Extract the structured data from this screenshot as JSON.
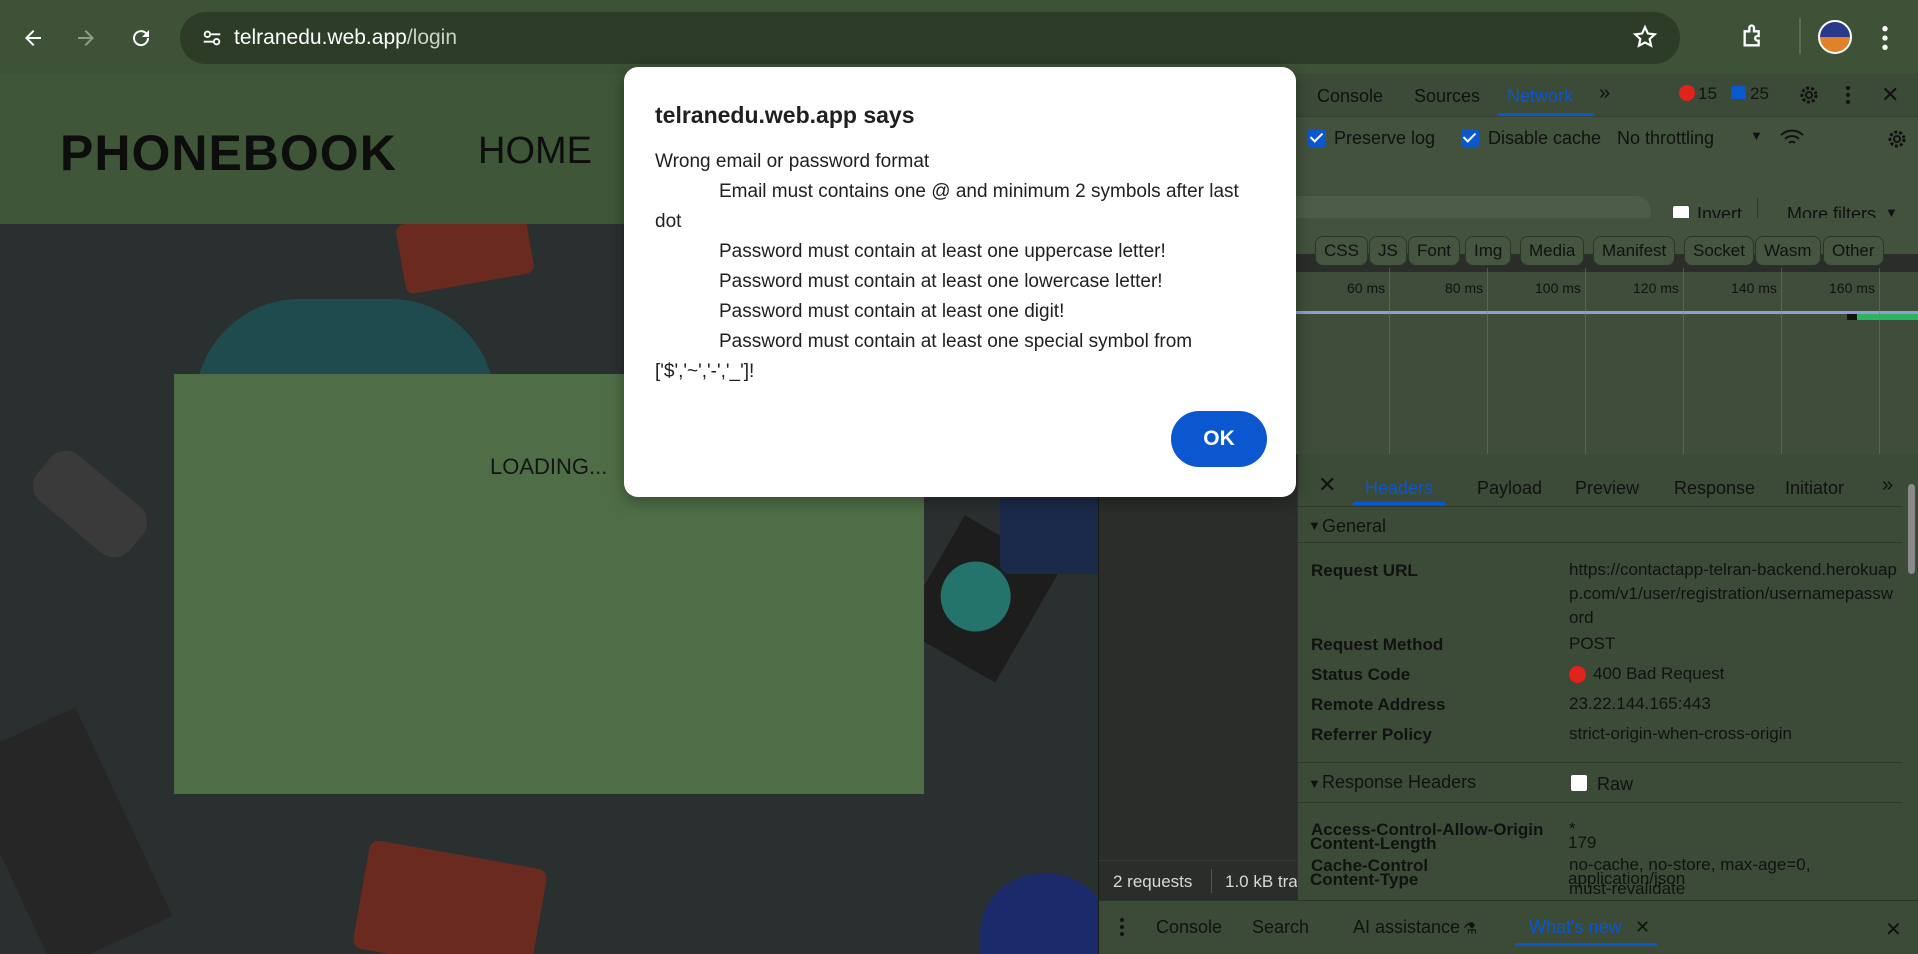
{
  "browser": {
    "url_host": "telranedu.web.app",
    "url_path": "/login"
  },
  "site": {
    "brand": "PHONEBOOK",
    "nav_home": "HOME",
    "loading": "LOADING..."
  },
  "alert": {
    "title": "telranedu.web.app says",
    "lines": [
      "Wrong email or password format",
      "Email must contains one @ and minimum 2 symbols after last dot",
      "Password must contain at least one uppercase letter!",
      "Password must contain at least one lowercase letter!",
      "Password must contain at least one digit!",
      "Password must contain at least one special symbol from ['$','~','-','_']!"
    ],
    "ok": "OK"
  },
  "devtools": {
    "tabs": {
      "console": "Console",
      "sources": "Sources",
      "network": "Network"
    },
    "errors": "15",
    "messages": "25",
    "preserve_log": "Preserve log",
    "disable_cache": "Disable cache",
    "throttling": "No throttling",
    "invert": "Invert",
    "more_filters": "More filters",
    "type_filters": [
      "CSS",
      "JS",
      "Font",
      "Img",
      "Media",
      "Manifest",
      "Socket",
      "Wasm",
      "Other"
    ],
    "ticks": [
      "60 ms",
      "80 ms",
      "100 ms",
      "120 ms",
      "140 ms",
      "160 ms"
    ],
    "footer": {
      "requests": "2 requests",
      "transferred": "1.0 kB tra"
    },
    "detail_tabs": {
      "headers": "Headers",
      "payload": "Payload",
      "preview": "Preview",
      "response": "Response",
      "initiator": "Initiator"
    },
    "general": {
      "title": "General",
      "request_url_key": "Request URL",
      "request_url": "https://contactapp-telran-backend.herokuapp.com/v1/user/registration/usernamepassword",
      "request_method_key": "Request Method",
      "request_method": "POST",
      "status_code_key": "Status Code",
      "status_code": "400 Bad Request",
      "remote_address_key": "Remote Address",
      "remote_address": "23.22.144.165:443",
      "referrer_policy_key": "Referrer Policy",
      "referrer_policy": "strict-origin-when-cross-origin"
    },
    "response_headers": {
      "title": "Response Headers",
      "raw": "Raw",
      "acao_key": "Access-Control-Allow-Origin",
      "acao": "*",
      "cache_control_key": "Cache-Control",
      "cache_control": "no-cache, no-store, max-age=0, must-revalidate",
      "content_length_key": "Content-Length",
      "content_length": "179",
      "content_type_key": "Content-Type",
      "content_type": "application/json"
    },
    "drawer": {
      "console": "Console",
      "search": "Search",
      "ai": "AI assistance",
      "whats_new": "What's new"
    },
    "colors": {
      "accent": "#0b57d0",
      "error": "#e0231b"
    }
  }
}
